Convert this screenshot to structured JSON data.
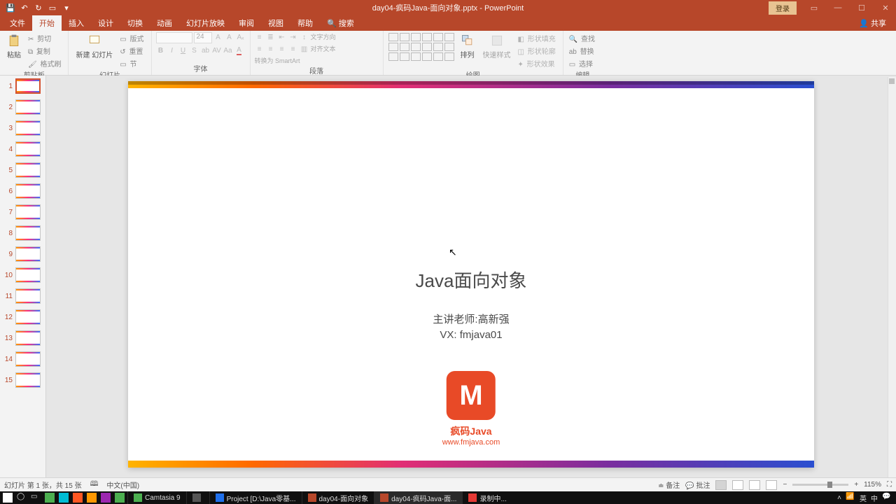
{
  "title": {
    "filename": "day04-疯码Java-面向对象.pptx - PowerPoint"
  },
  "login_label": "登录",
  "share_label": "共享",
  "tabs": {
    "file": "文件",
    "home": "开始",
    "insert": "插入",
    "design": "设计",
    "trans": "切换",
    "anim": "动画",
    "slideshow": "幻灯片放映",
    "review": "审阅",
    "view": "视图",
    "help": "帮助",
    "search": "搜索"
  },
  "ribbon": {
    "clipboard": {
      "paste": "粘贴",
      "cut": "剪切",
      "copy": "复制",
      "format": "格式刷",
      "label": "剪贴板"
    },
    "slides": {
      "new": "新建\n幻灯片",
      "layout": "版式",
      "reset": "重置",
      "section": "节",
      "label": "幻灯片"
    },
    "font": {
      "size": "24",
      "label": "字体"
    },
    "paragraph": {
      "textdir": "文字方向",
      "align": "对齐文本",
      "smart": "转换为 SmartArt",
      "label": "段落"
    },
    "drawing": {
      "arrange": "排列",
      "quick": "快速样式",
      "fill": "形状填充",
      "outline": "形状轮廓",
      "effects": "形状效果",
      "label": "绘图"
    },
    "editing": {
      "find": "查找",
      "replace": "替换",
      "select": "选择",
      "label": "编辑"
    }
  },
  "thumbs": [
    "1",
    "2",
    "3",
    "4",
    "5",
    "6",
    "7",
    "8",
    "9",
    "10",
    "11",
    "12",
    "13",
    "14",
    "15"
  ],
  "slide": {
    "title": "Java面向对象",
    "teacher": "主讲老师:高新强",
    "vx": "VX:   fmjava01",
    "brand": "疯码Java",
    "url": "www.fmjava.com",
    "logo_letter": "M"
  },
  "status": {
    "slideinfo": "幻灯片 第 1 张，共 15 张",
    "lang": "中文(中国)",
    "notes": "备注",
    "comments": "批注",
    "zoom": "115%"
  },
  "taskbar": {
    "apps": [
      {
        "label": "Camtasia 9"
      },
      {
        "label": ""
      },
      {
        "label": "Project [D:\\Java零基..."
      },
      {
        "label": "day04-面向对象"
      },
      {
        "label": "day04-疯码Java-面..."
      },
      {
        "label": "录制中..."
      }
    ],
    "ime": "英",
    "ime2": "中"
  }
}
